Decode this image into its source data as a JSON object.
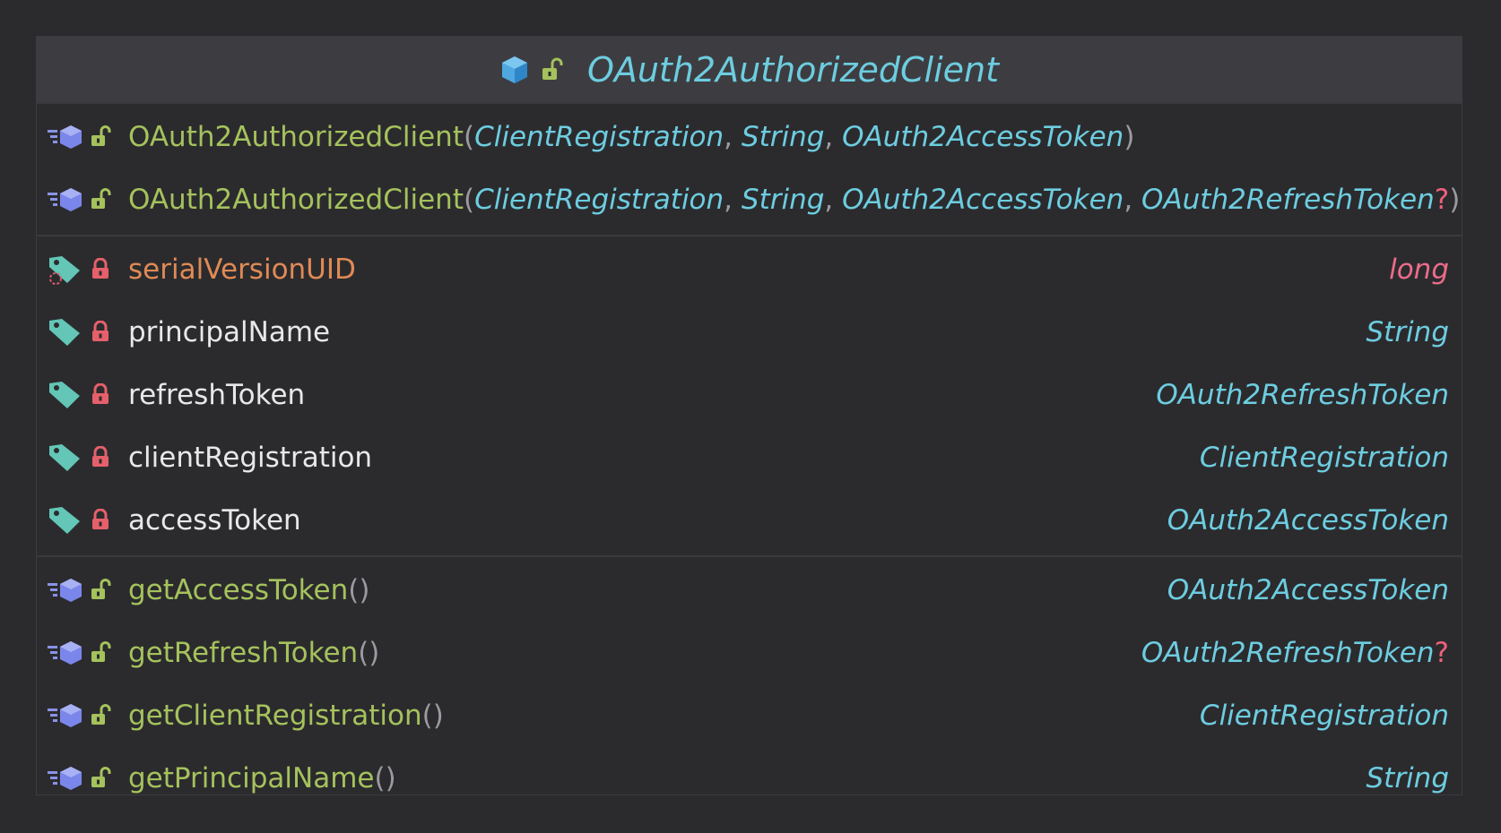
{
  "class": {
    "name": "OAuth2AuthorizedClient",
    "icon": "class-icon",
    "visibility_icon": "public-unlock-icon"
  },
  "constructors": [
    {
      "name": "OAuth2AuthorizedClient",
      "params": [
        "ClientRegistration",
        "String",
        "OAuth2AccessToken"
      ],
      "open": "(",
      "close": ")",
      "sep": ","
    },
    {
      "name": "OAuth2AuthorizedClient",
      "params": [
        "ClientRegistration",
        "String",
        "OAuth2AccessToken",
        "OAuth2RefreshToken"
      ],
      "last_nullable": "?",
      "open": "(",
      "close": ")",
      "sep": ","
    }
  ],
  "fields": [
    {
      "name": "serialVersionUID",
      "type": "long",
      "static": true
    },
    {
      "name": "principalName",
      "type": "String"
    },
    {
      "name": "refreshToken",
      "type": "OAuth2RefreshToken"
    },
    {
      "name": "clientRegistration",
      "type": "ClientRegistration"
    },
    {
      "name": "accessToken",
      "type": "OAuth2AccessToken"
    }
  ],
  "methods": [
    {
      "name": "getAccessToken",
      "parens": "()",
      "type": "OAuth2AccessToken"
    },
    {
      "name": "getRefreshToken",
      "parens": "()",
      "type": "OAuth2RefreshToken",
      "nullable": "?"
    },
    {
      "name": "getClientRegistration",
      "parens": "()",
      "type": "ClientRegistration"
    },
    {
      "name": "getPrincipalName",
      "parens": "()",
      "type": "String"
    }
  ],
  "colors": {
    "background": "#2b2b2e",
    "header": "#3d3d41",
    "type": "#6dcde0",
    "method": "#a5c25c",
    "field": "#e8e8e8",
    "constant": "#e08a55",
    "primitive": "#ec6c8a",
    "private_lock": "#e5606a",
    "public_lock": "#a5c25c"
  }
}
